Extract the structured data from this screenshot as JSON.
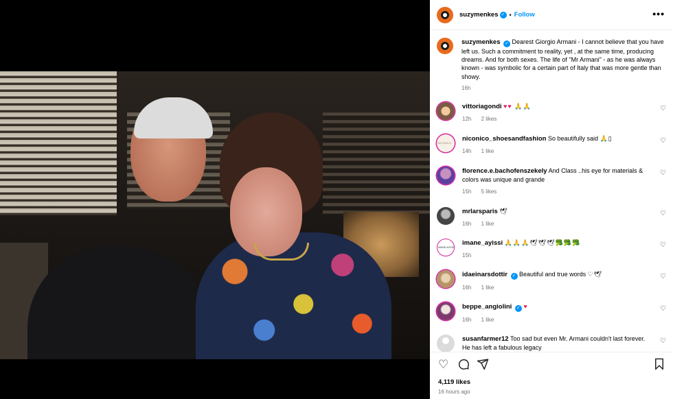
{
  "post": {
    "username": "suzymenkes",
    "follow_label": "Follow",
    "dot": "•",
    "more_label": "•••",
    "verified_mark": "✓",
    "caption": "Dearest Giorgio Armani - I cannot believe that you have left us. Such a commitment to reality, yet , at the same time, producing dreams. And for both sexes. The life of \"Mr Armani\" - as he was always known - was symbolic for a certain part of Italy that was more gentle than showy.",
    "caption_time": "16h",
    "likes": "4,119 likes",
    "time_ago": "16 hours ago"
  },
  "comments": [
    {
      "user": "vittoriagondi",
      "verified": false,
      "text": "",
      "emoji": "♥♥ 🙏🙏",
      "time": "12h",
      "likes": "2 likes",
      "reply": ""
    },
    {
      "user": "niconico_shoesandfashion",
      "verified": false,
      "text": "So beautifully said",
      "emoji": "🙏▯",
      "time": "14h",
      "likes": "1 like",
      "reply": ""
    },
    {
      "user": "florence.e.bachofenszekely",
      "verified": false,
      "text": "And Class ..his eye for materials & colors was unique and grande",
      "emoji": "",
      "time": "15h",
      "likes": "5 likes",
      "reply": ""
    },
    {
      "user": "mrlarsparis",
      "verified": false,
      "text": "",
      "emoji": "🕊",
      "time": "16h",
      "likes": "1 like",
      "reply": ""
    },
    {
      "user": "imane_ayissi",
      "verified": false,
      "text": "",
      "emoji": "🙏🙏🙏🕊🕊🕊🥦🥦🥦",
      "time": "15h",
      "likes": "",
      "reply": ""
    },
    {
      "user": "idaeinarsdottir",
      "verified": true,
      "text": "Beautiful and true words",
      "emoji": "♡🕊",
      "time": "16h",
      "likes": "1 like",
      "reply": ""
    },
    {
      "user": "beppe_angiolini",
      "verified": true,
      "text": "",
      "emoji": "♥",
      "time": "16h",
      "likes": "1 like",
      "reply": ""
    },
    {
      "user": "susanfarmer12",
      "verified": false,
      "text": "Too sad but even Mr. Armani couldn't last forever. He has left a fabulous legacy",
      "emoji": "",
      "time": "",
      "likes": "",
      "reply": ""
    }
  ],
  "icons": {
    "like": "heart-icon",
    "comment": "comment-icon",
    "share": "share-icon",
    "save": "bookmark-icon"
  },
  "colors": {
    "accent": "#0095f6",
    "secondary_text": "#737373",
    "heart_red": "#e0245e"
  }
}
